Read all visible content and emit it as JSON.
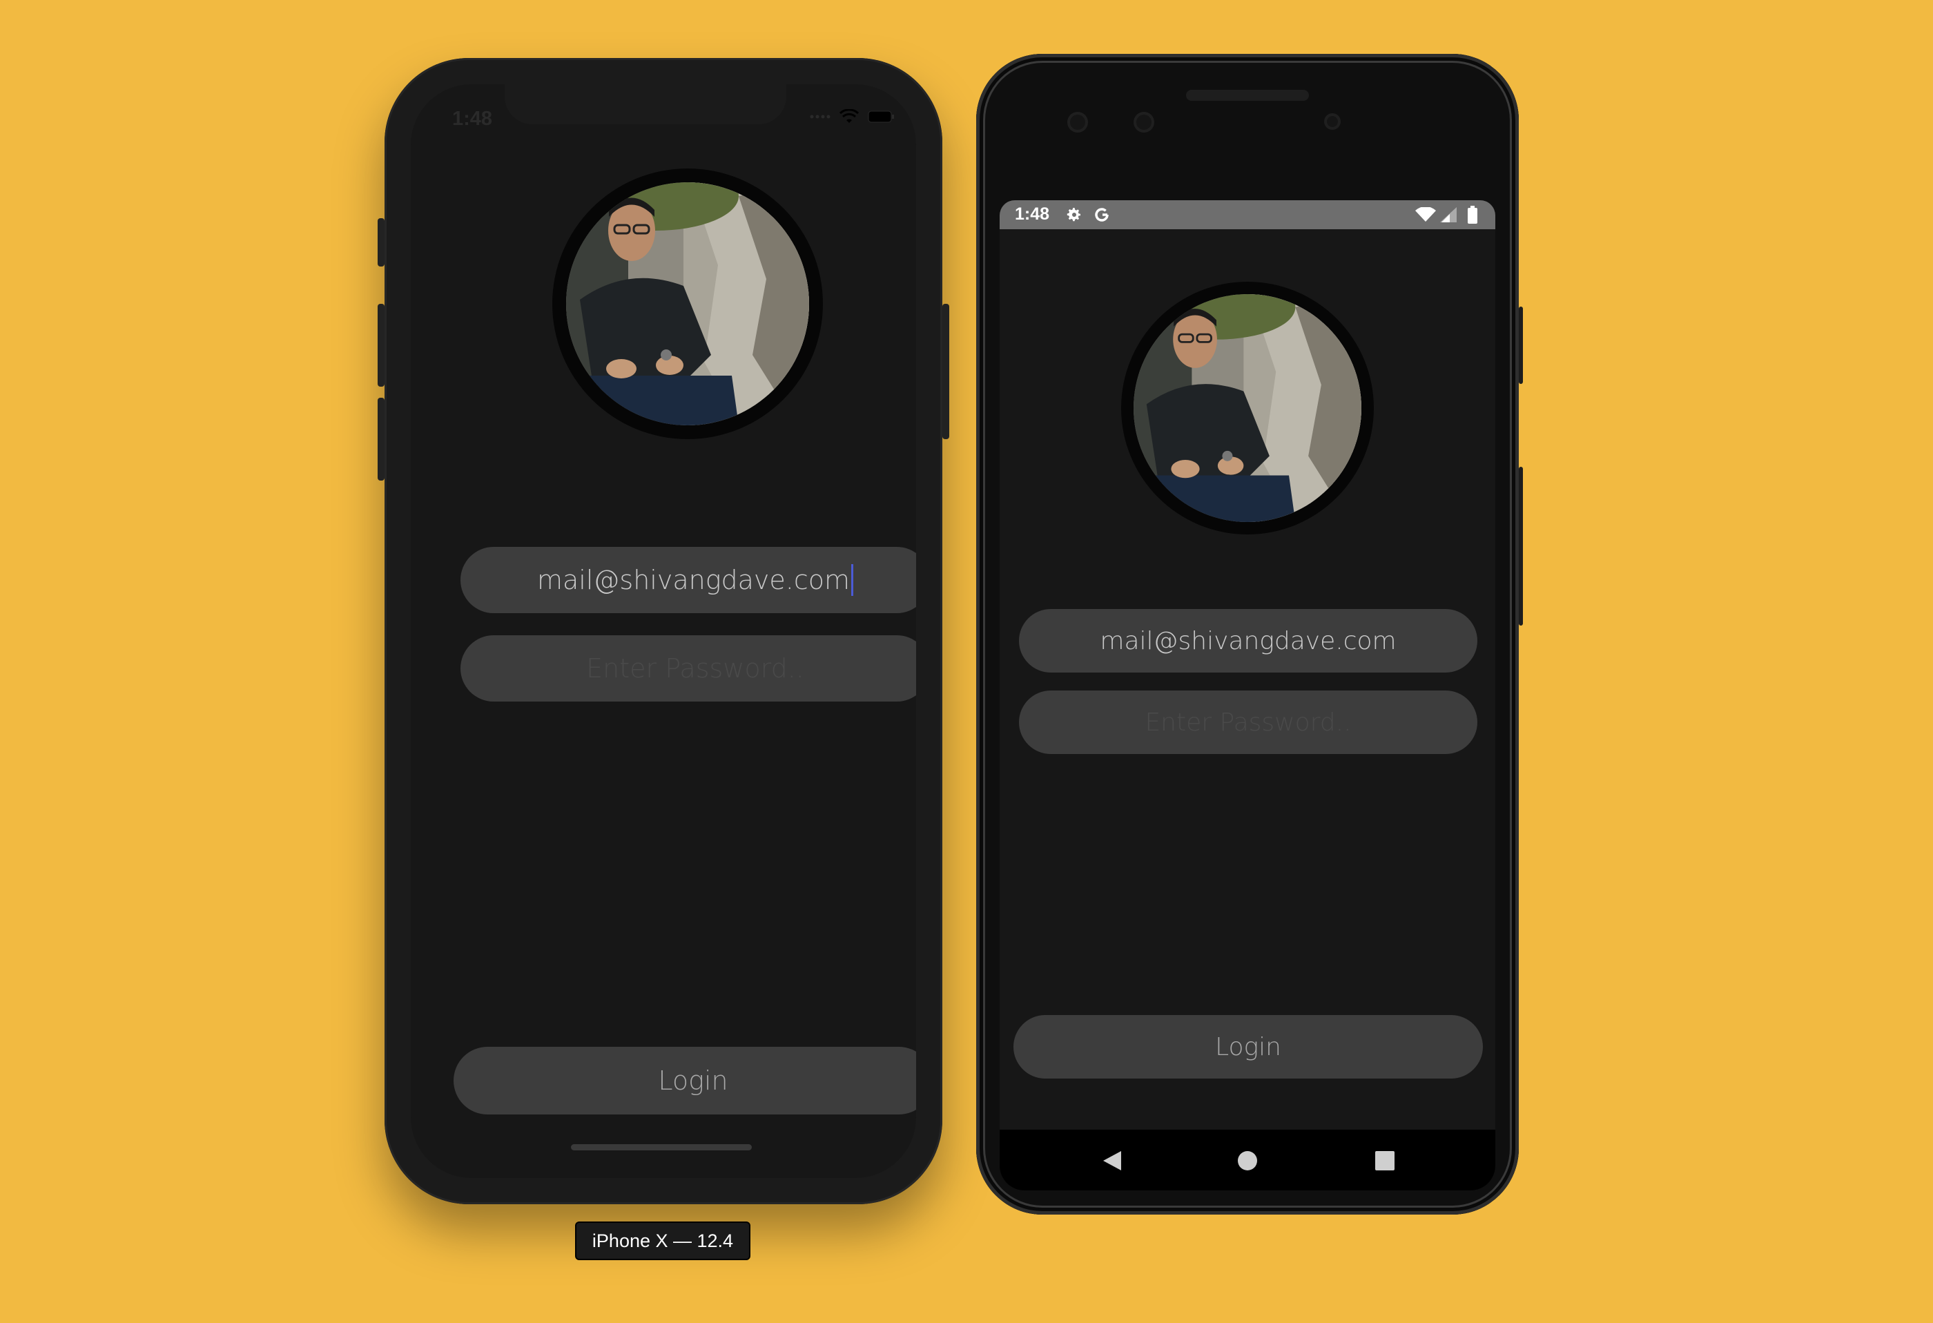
{
  "background_color": "#F2BA41",
  "ios": {
    "status_time": "1:48",
    "email_value": "mail@shivangdave.com",
    "password_placeholder": "Enter Password..",
    "login_label": "Login",
    "device_label": "iPhone X — 12.4",
    "icons": [
      "wifi-icon",
      "battery-icon",
      "signal-dots-icon"
    ]
  },
  "android": {
    "status_time": "1:48",
    "status_icons": [
      "settings-gear-icon",
      "google-g-icon",
      "wifi-icon",
      "signal-icon",
      "battery-icon"
    ],
    "email_value": "mail@shivangdave.com",
    "password_placeholder": "Enter Password..",
    "login_label": "Login",
    "nav_icons": [
      "back-icon",
      "home-icon",
      "recents-icon"
    ]
  },
  "colors": {
    "screen_bg": "#171717",
    "pill_bg": "#3d3d3d",
    "text": "#c9c9c9",
    "placeholder": "#4a4a4a",
    "caret": "#4b5bd6"
  }
}
